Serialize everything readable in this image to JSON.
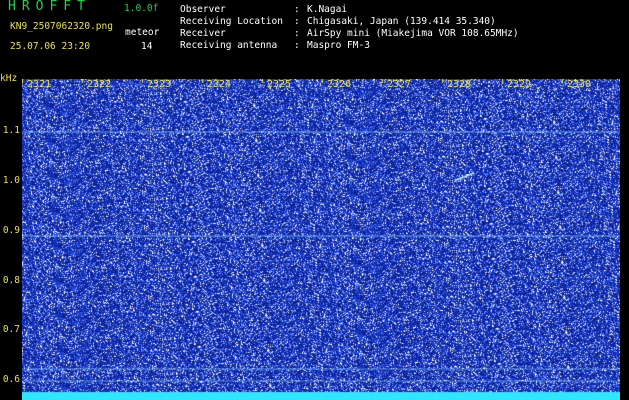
{
  "header": {
    "brand": "HROFFT",
    "version": "1.0.0f",
    "file": "KN9_2507062320.png",
    "mode_label": "meteor",
    "datetime": "25.07.06 23:20",
    "count": "14"
  },
  "info": {
    "observer_label": "Observer",
    "observer_value": "K.Nagai",
    "location_label": "Receiving Location",
    "location_value": "Chigasaki, Japan (139.414 35.340)",
    "receiver_label": "Receiver",
    "receiver_value": "AirSpy mini (Miakejima VOR 108.65MHz)",
    "antenna_label": "Receiving antenna",
    "antenna_value": "Maspro FM-3",
    "separator": ":"
  },
  "spectrogram": {
    "y_unit": "kHz",
    "y_ticks": [
      "1.1",
      "1.0",
      "0.9",
      "0.8",
      "0.7",
      "0.6"
    ],
    "x_ticks": [
      "2321",
      "2322",
      "2323",
      "2324",
      "2325",
      "2326",
      "2327",
      "2328",
      "2329",
      "2330"
    ],
    "colors": {
      "background": "#0a1e8c",
      "noise": "#ffffff",
      "line": "#8fd8ff",
      "baseline": "#2fe6ff",
      "axis": "#e8e24a"
    }
  }
}
